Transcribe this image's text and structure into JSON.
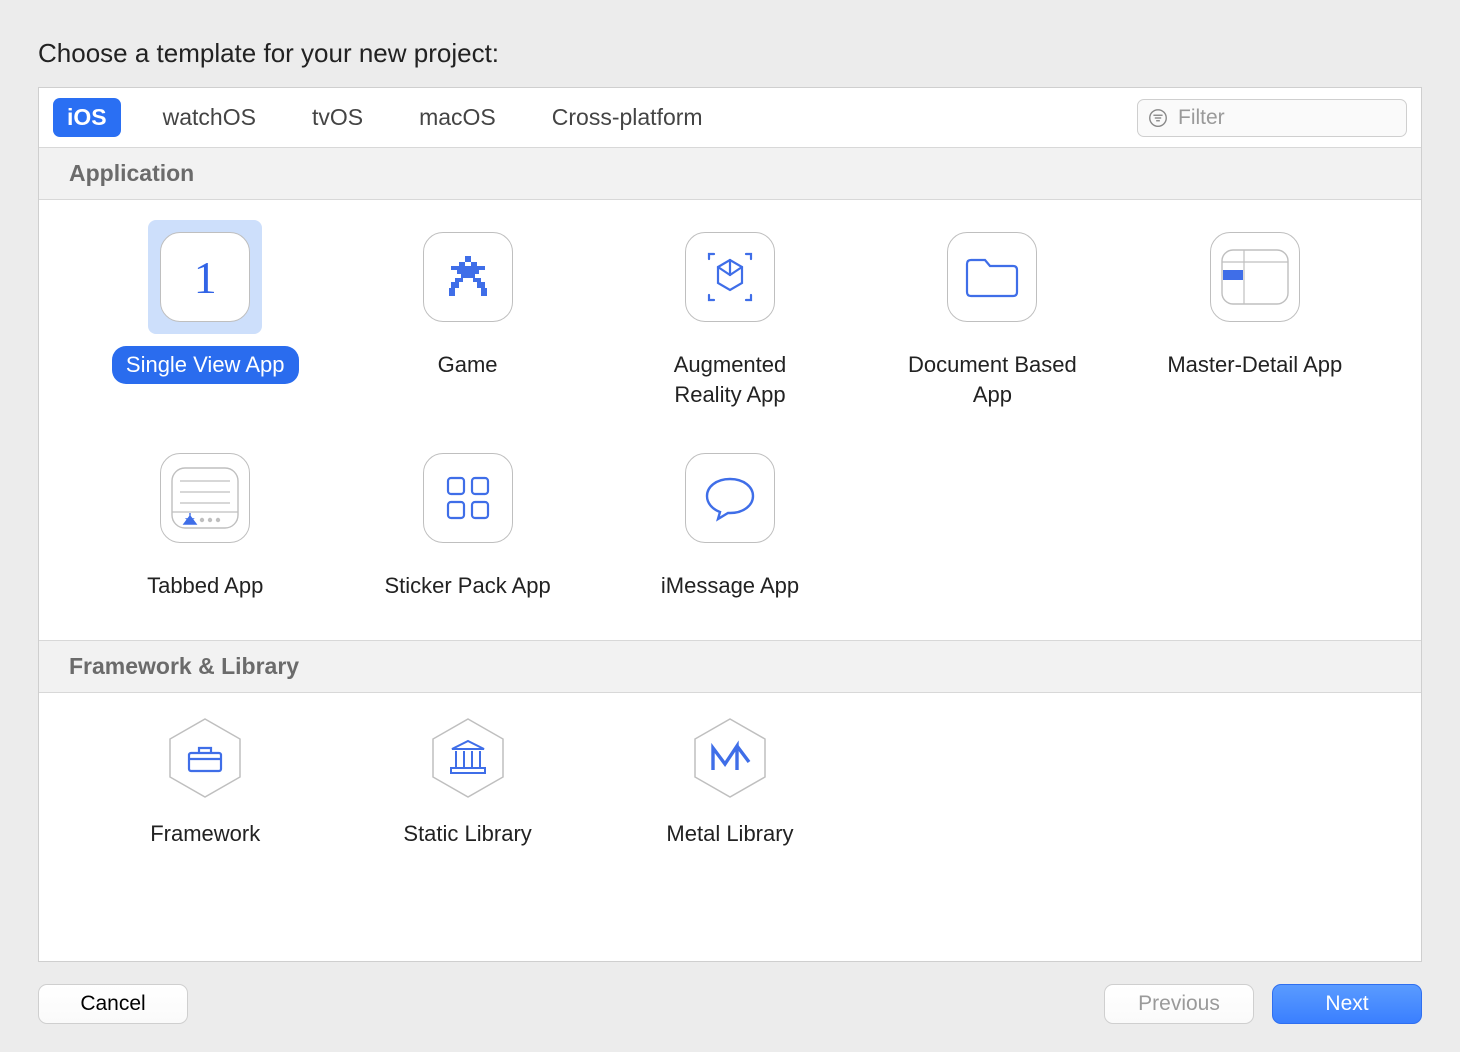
{
  "title": "Choose a template for your new project:",
  "tabs": [
    "iOS",
    "watchOS",
    "tvOS",
    "macOS",
    "Cross-platform"
  ],
  "activeTab": "iOS",
  "filterPlaceholder": "Filter",
  "sections": {
    "app": "Application",
    "fw": "Framework & Library"
  },
  "templates": {
    "app": [
      {
        "label": "Single View App",
        "icon": "single-view",
        "selected": true
      },
      {
        "label": "Game",
        "icon": "game"
      },
      {
        "label": "Augmented Reality App",
        "icon": "arkit"
      },
      {
        "label": "Document Based App",
        "icon": "folder"
      },
      {
        "label": "Master-Detail App",
        "icon": "master-detail"
      },
      {
        "label": "Tabbed App",
        "icon": "tabbed"
      },
      {
        "label": "Sticker Pack App",
        "icon": "sticker"
      },
      {
        "label": "iMessage App",
        "icon": "imessage"
      }
    ],
    "fw": [
      {
        "label": "Framework",
        "icon": "toolbox"
      },
      {
        "label": "Static Library",
        "icon": "library"
      },
      {
        "label": "Metal Library",
        "icon": "metal"
      }
    ]
  },
  "buttons": {
    "cancel": "Cancel",
    "previous": "Previous",
    "next": "Next"
  }
}
